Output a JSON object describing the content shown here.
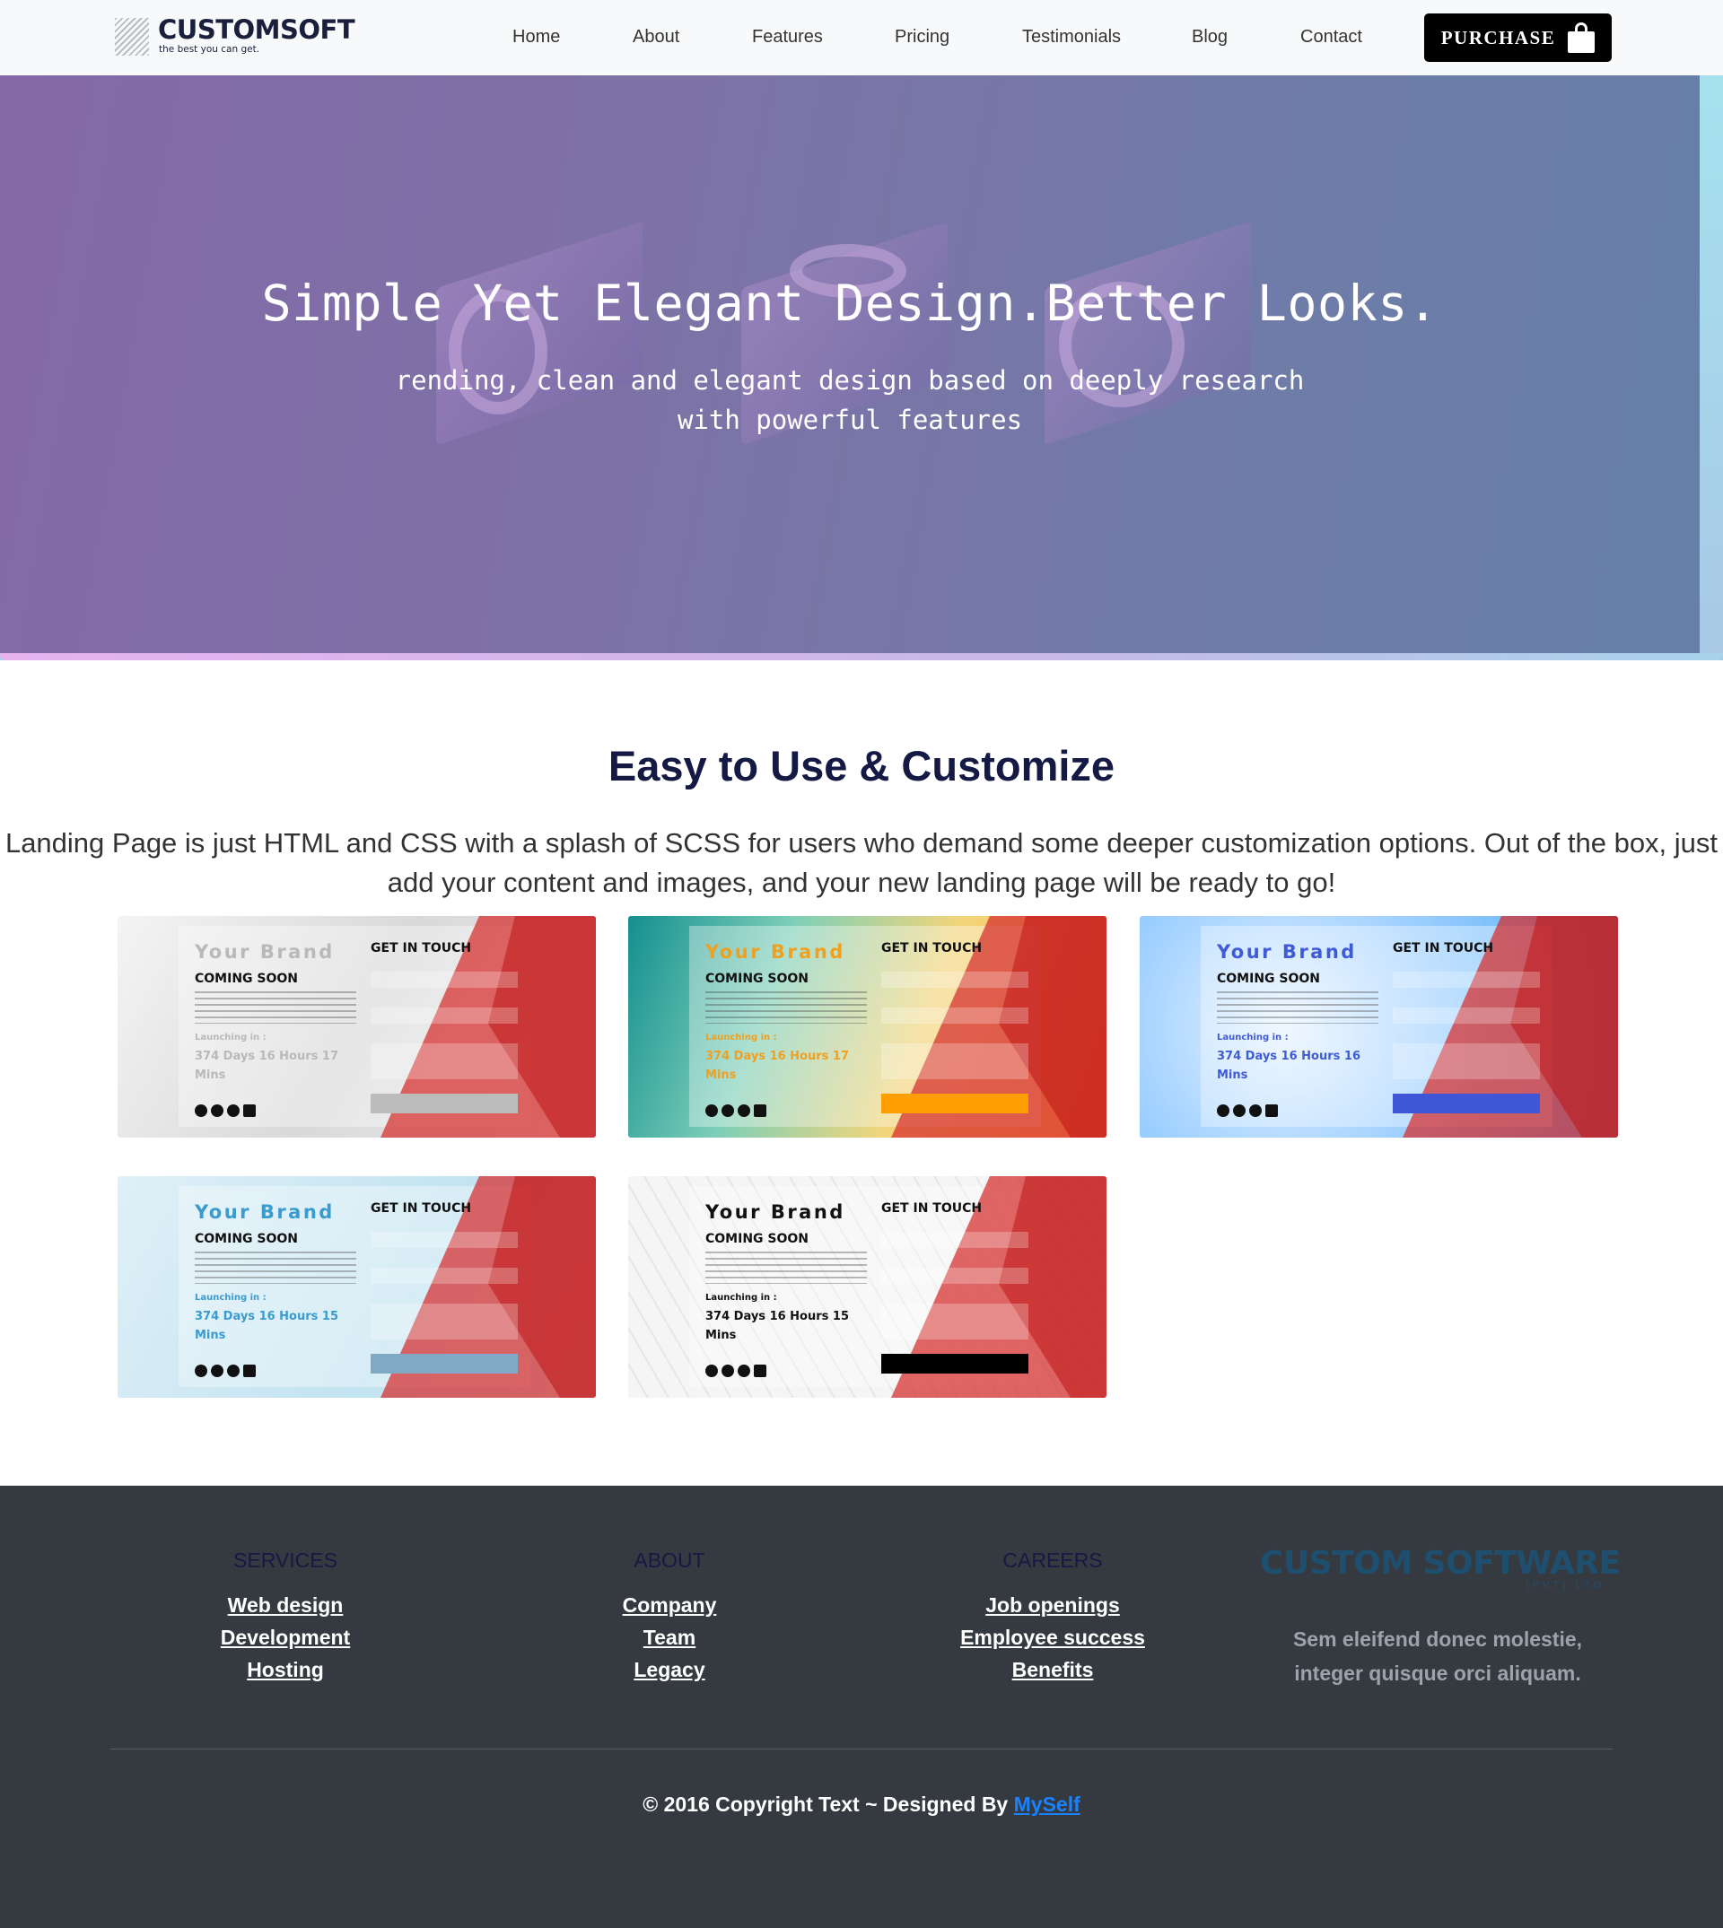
{
  "navbar": {
    "logo_title": "CUSTOMSOFT",
    "logo_tagline": "the best you can get.",
    "links": [
      "Home",
      "About",
      "Features",
      "Pricing",
      "Testimonials",
      "Blog",
      "Contact"
    ],
    "purchase_label": "PURCHASE",
    "purchase_icon": "shopping-bag-icon"
  },
  "hero": {
    "title": "Simple Yet Elegant Design.Better Looks.",
    "subtitle": "rending, clean and elegant design based on deeply research with powerful features"
  },
  "features": {
    "title": "Easy to Use & Customize",
    "description": "Landing Page is just HTML and CSS with a splash of SCSS for users who demand some deeper customization options. Out of the box, just add your content and images, and your new landing page will be ready to go!",
    "thumbnails": [
      {
        "brand": "Your Brand",
        "coming": "COMING SOON",
        "launch": "Launching in :",
        "countdown": "374 Days 16 Hours 17 Mins",
        "contact": "GET IN TOUCH",
        "accent": "#b9b9b9"
      },
      {
        "brand": "Your Brand",
        "coming": "COMING SOON",
        "launch": "Launching in :",
        "countdown": "374 Days 16 Hours 17 Mins",
        "contact": "GET IN TOUCH",
        "accent": "#f0a020"
      },
      {
        "brand": "Your Brand",
        "coming": "COMING SOON",
        "launch": "Launching in :",
        "countdown": "374 Days 16 Hours 16 Mins",
        "contact": "GET IN TOUCH",
        "accent": "#3f5cd6"
      },
      {
        "brand": "Your Brand",
        "coming": "COMING SOON",
        "launch": "Launching in :",
        "countdown": "374 Days 16 Hours 15 Mins",
        "contact": "GET IN TOUCH",
        "accent": "#3a9bcf"
      },
      {
        "brand": "Your Brand",
        "coming": "COMING SOON",
        "launch": "Launching in :",
        "countdown": "374 Days 16 Hours 15 Mins",
        "contact": "GET IN TOUCH",
        "accent": "#111111"
      }
    ]
  },
  "footer": {
    "columns": [
      {
        "title": "SERVICES",
        "links": [
          "Web design",
          "Development",
          "Hosting"
        ]
      },
      {
        "title": "ABOUT",
        "links": [
          "Company",
          "Team",
          "Legacy"
        ]
      },
      {
        "title": "CAREERS",
        "links": [
          "Job openings",
          "Employee success",
          "Benefits"
        ]
      }
    ],
    "brand_name": "CUSTOM SOFTWARE",
    "brand_suffix": "(PVT) LTD",
    "brand_description": "Sem eleifend donec molestie, integer quisque orci aliquam.",
    "copyright_text": "© 2016 Copyright Text ~ Designed By",
    "copyright_link": "MySelf"
  }
}
